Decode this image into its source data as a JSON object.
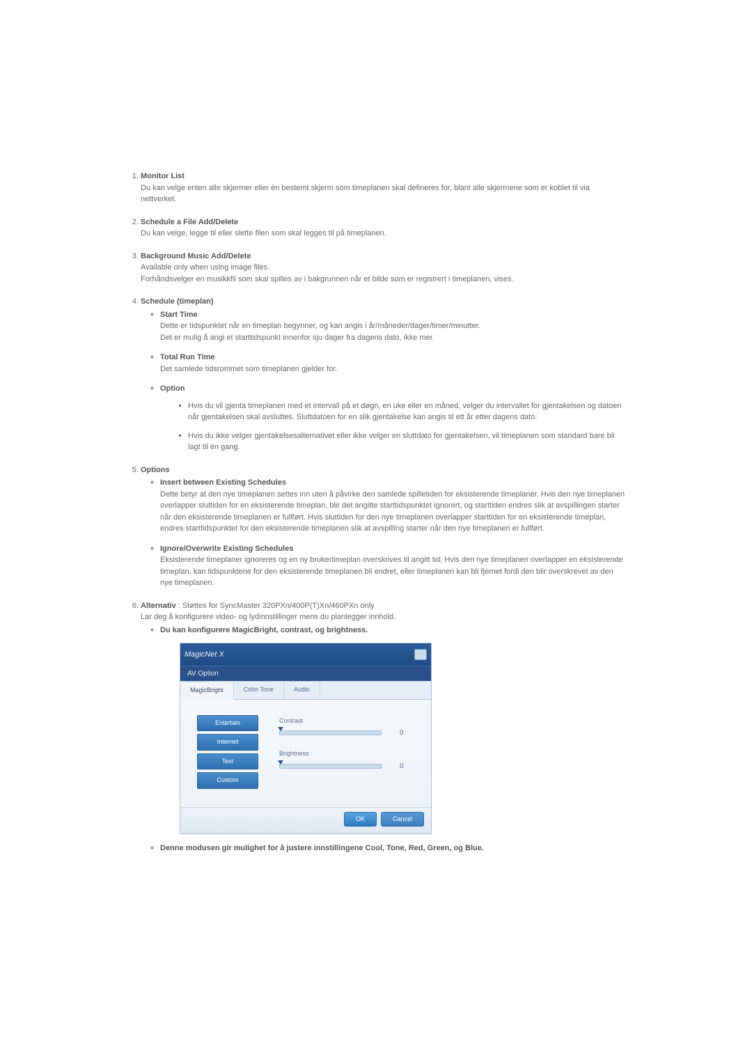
{
  "items": {
    "i1": {
      "title": "Monitor List",
      "text": "Du kan velge enten alle skjermer eller én bestemt skjerm som timeplanen skal defineres for, blant alle skjermene som er koblet til via nettverket."
    },
    "i2": {
      "title": "Schedule a File Add/Delete",
      "text": "Du kan velge, legge til eller slette filen som skal legges til på timeplanen."
    },
    "i3": {
      "title": "Background Music Add/Delete",
      "line1": "Available only when using image files.",
      "line2": "Forhåndsvelger en musikkfil som skal spilles av i bakgrunnen når et bilde som er registrert i timeplanen, vises."
    },
    "i4": {
      "title": "Schedule (timeplan)",
      "sub": {
        "start": {
          "title": "Start Time",
          "l1": "Dette er tidspunktet når en timeplan begynner, og kan angis i år/måneder/dager/timer/minutter.",
          "l2": "Det er mulig å angi et starttidspunkt innenfor sju dager fra dagens dato, ikke mer."
        },
        "total": {
          "title": "Total Run Time",
          "l1": "Det samlede tidsrommet som timeplanen gjelder for."
        },
        "option": {
          "title": "Option",
          "b1": "Hvis du vil gjenta timeplanen med et intervall på et døgn, en uke eller en måned, velger du intervallet for gjentakelsen og datoen når gjentakelsen skal avsluttes. Sluttdatoen for en slik gjentakelse kan angis til ett år etter dagens dato.",
          "b2": "Hvis du ikke velger gjentakelsesalternativet eller ikke velger en sluttdato for gjentakelsen, vil timeplanen som standard bare bli lagt til én gang."
        }
      }
    },
    "i5": {
      "title": "Options",
      "sub": {
        "insert": {
          "title": "Insert between Existing Schedules",
          "text": "Dette betyr at den nye timeplanen settes inn uten å påvirke den samlede spilletiden for eksisterende timeplaner. Hvis den nye timeplanen overlapper sluttiden for en eksisterende timeplan, blir det angitte starttidspunktet ignorert, og starttiden endres slik at avspillingen starter når den eksisterende timeplanen er fullført. Hvis sluttiden for den nye timeplanen overlapper starttiden for en eksisterende timeplan, endres starttidspunktet for den eksisterende timeplanen slik at avspilling starter når den nye timeplanen er fullført."
        },
        "ignore": {
          "title": "Ignore/Overwrite Existing Schedules",
          "text": "Eksisterende timeplaner ignoreres og en ny brukertimeplan overskrives til angitt tid. Hvis den nye timeplanen overlapper en eksisterende timeplan, kan tidspunktene for den eksisterende timeplanen bli endret, eller timeplanen kan bli fjernet fordi den blir overskrevet av den nye timeplanen."
        }
      }
    },
    "i6": {
      "title": "Alternativ",
      "suffix": " : Støttes for SyncMaster 320PXn/400P(T)Xn/460PXn only",
      "text": "Lar deg å konfigurere video- og lydinnstillinger mens du planlegger innhold.",
      "sub": {
        "config": "Du kan konfigurere MagicBright, contrast, og brightness.",
        "mode": "Denne modusen gir mulighet for å justere innstillingene Cool, Tone, Red, Green, og Blue."
      }
    }
  },
  "dialog": {
    "logo": "MagicNet X",
    "subtitle": "AV Option",
    "tabs": {
      "t1": "MagicBright",
      "t2": "Color Tone",
      "t3": "Audio"
    },
    "presets": {
      "p1": "Entertain",
      "p2": "Internet",
      "p3": "Text",
      "p4": "Custom"
    },
    "sliders": {
      "contrast": {
        "label": "Contrast",
        "value": "0"
      },
      "brightness": {
        "label": "Brightness",
        "value": "0"
      }
    },
    "buttons": {
      "ok": "OK",
      "cancel": "Cancel"
    }
  }
}
